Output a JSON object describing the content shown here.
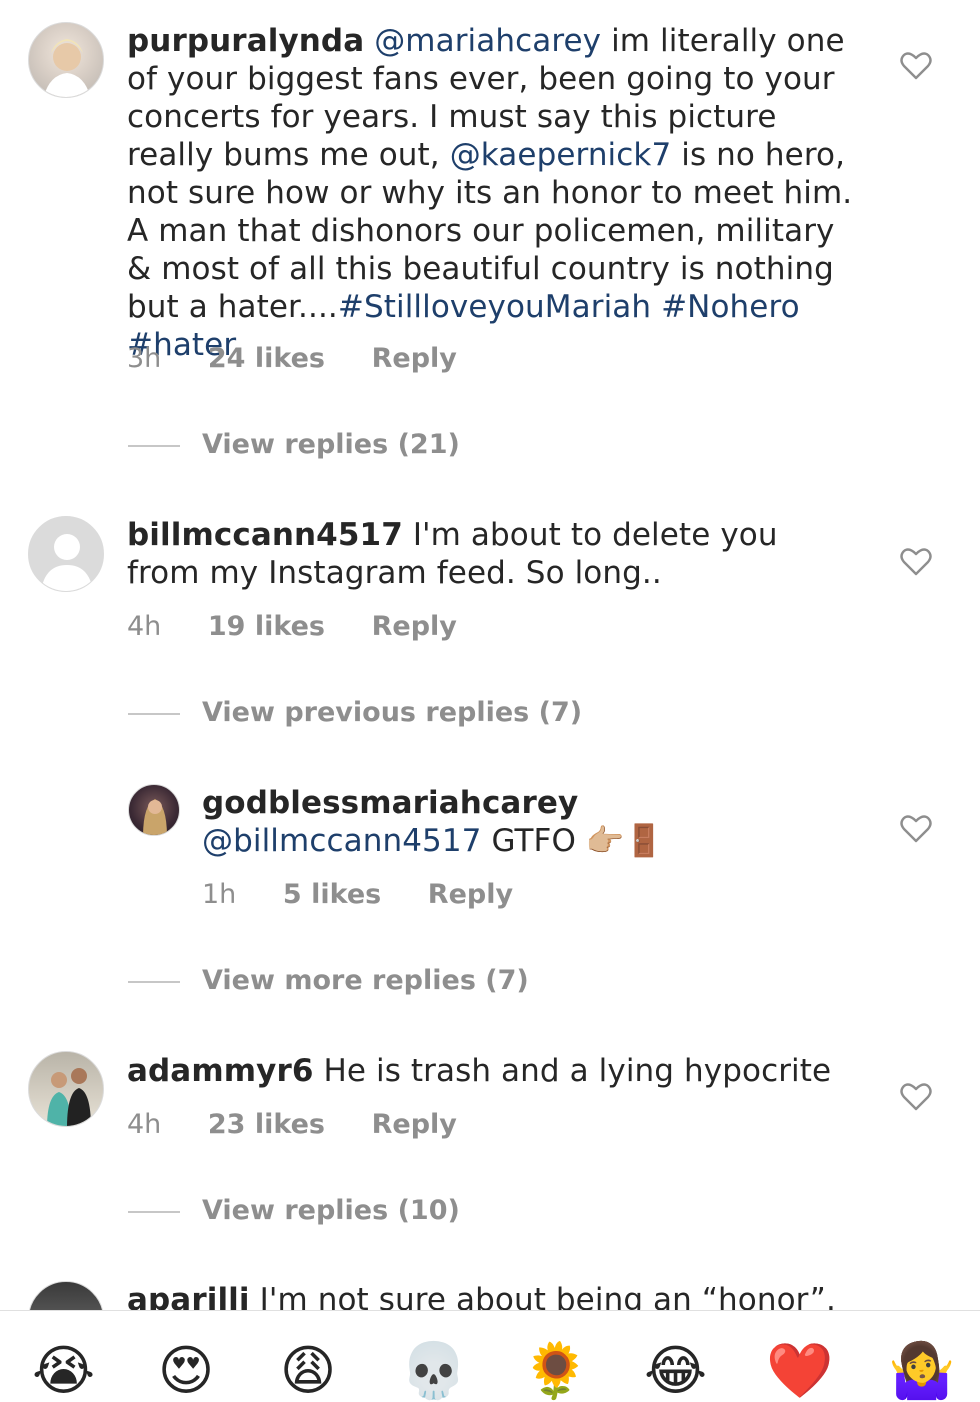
{
  "comments": [
    {
      "username": "purpuralynda",
      "text_parts": [
        {
          "t": "@mariahcarey",
          "type": "mention"
        },
        {
          "t": " im literally one of your biggest fans ever, been going to your concerts for years.  I must say this picture really bums me out, ",
          "type": "text"
        },
        {
          "t": "@kaepernick7",
          "type": "mention"
        },
        {
          "t": " is no hero, not sure how or why its an honor to meet him. A man that dishonors our policemen, military & most of all this beautiful country is nothing but a hater....",
          "type": "text"
        },
        {
          "t": "#StillloveyouMariah",
          "type": "tag"
        },
        {
          "t": " ",
          "type": "text"
        },
        {
          "t": "#Nohero",
          "type": "tag"
        },
        {
          "t": " ",
          "type": "text"
        },
        {
          "t": "#hater",
          "type": "tag"
        }
      ],
      "time": "3h",
      "likes": "24 likes",
      "reply": "Reply",
      "view_replies": "View replies (21)"
    },
    {
      "username": "billmccann4517",
      "text_parts": [
        {
          "t": " I'm about to delete you from my Instagram feed. So long..",
          "type": "text"
        }
      ],
      "time": "4h",
      "likes": "19 likes",
      "reply": "Reply",
      "view_replies": "View previous replies (7)"
    },
    {
      "username": "godblessmariahcarey",
      "text_parts": [
        {
          "t": " @billmccann4517",
          "type": "mention"
        },
        {
          "t": " GTFO 👉🏼🚪",
          "type": "text"
        }
      ],
      "time": "1h",
      "likes": "5 likes",
      "reply": "Reply",
      "view_replies": "View more replies (7)"
    },
    {
      "username": "adammyr6",
      "text_parts": [
        {
          "t": " He is trash and a lying hypocrite",
          "type": "text"
        }
      ],
      "time": "4h",
      "likes": "23 likes",
      "reply": "Reply",
      "view_replies": "View replies (10)"
    },
    {
      "username": "aparilli",
      "text_parts": [
        {
          "t": " I'm not sure about being an “honor”.",
          "type": "text"
        }
      ]
    }
  ],
  "emoji_bar": [
    "😭",
    "😍",
    "😩",
    "💀",
    "🌻",
    "😂",
    "❤️",
    "🤷‍♀️"
  ],
  "emoji_names": [
    "loudly-crying-face",
    "heart-eyes",
    "weary-face",
    "skull",
    "sunflower",
    "tears-of-joy",
    "red-heart",
    "woman-shrugging"
  ],
  "colors": {
    "link": "#1e3f6b",
    "meta": "#8e8e8e",
    "text": "#262626"
  }
}
